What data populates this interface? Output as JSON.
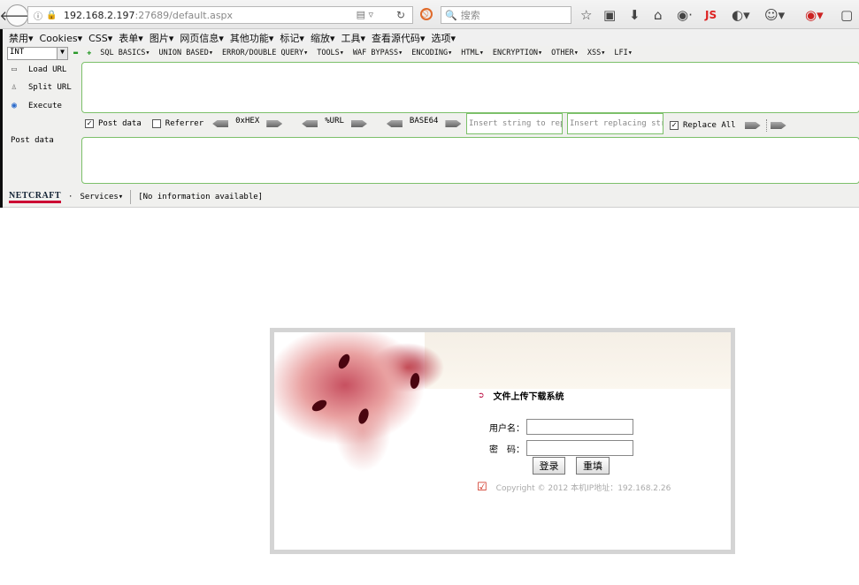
{
  "nav": {
    "url_host": "192.168.2.197",
    "url_path": ":27689/default.aspx",
    "search_placeholder": "搜索"
  },
  "menubar": {
    "items": [
      "禁用▾",
      "Cookies▾",
      "CSS▾",
      "表单▾",
      "图片▾",
      "网页信息▾",
      "其他功能▾",
      "标记▾",
      "缩放▾",
      "工具▾",
      "查看源代码▾",
      "选项▾"
    ]
  },
  "hackbar": {
    "select_value": "INT",
    "menu": [
      "SQL BASICS▾",
      "UNION BASED▾",
      "ERROR/DOUBLE QUERY▾",
      "TOOLS▾",
      "WAF BYPASS▾",
      "ENCODING▾",
      "HTML▾",
      "ENCRYPTION▾",
      "OTHER▾",
      "XSS▾",
      "LFI▾"
    ],
    "load_url": "Load URL",
    "split_url": "Split URL",
    "execute": "Execute",
    "post_data_cb": "Post data",
    "referrer_cb": "Referrer",
    "hex_label": "0xHEX",
    "urlenc_label": "%URL",
    "base64_label": "BASE64",
    "insert_string_placeholder": "Insert string to replace",
    "insert_replacing_placeholder": "Insert replacing string",
    "replace_all": "Replace All",
    "post_label": "Post data"
  },
  "netcraft": {
    "logo": "NETCRAFT",
    "services": "Services▾",
    "info": "[No information available]"
  },
  "login": {
    "title": "文件上传下载系统",
    "username_label": "用户名：",
    "password_label": "密　码：",
    "login_btn": "登录",
    "reset_btn": "重填",
    "copyright": "Copyright © 2012 本机IP地址：192.168.2.26"
  },
  "colors": {
    "accent_green": "#7cc06a",
    "copyright_mark": "#cc2211"
  }
}
